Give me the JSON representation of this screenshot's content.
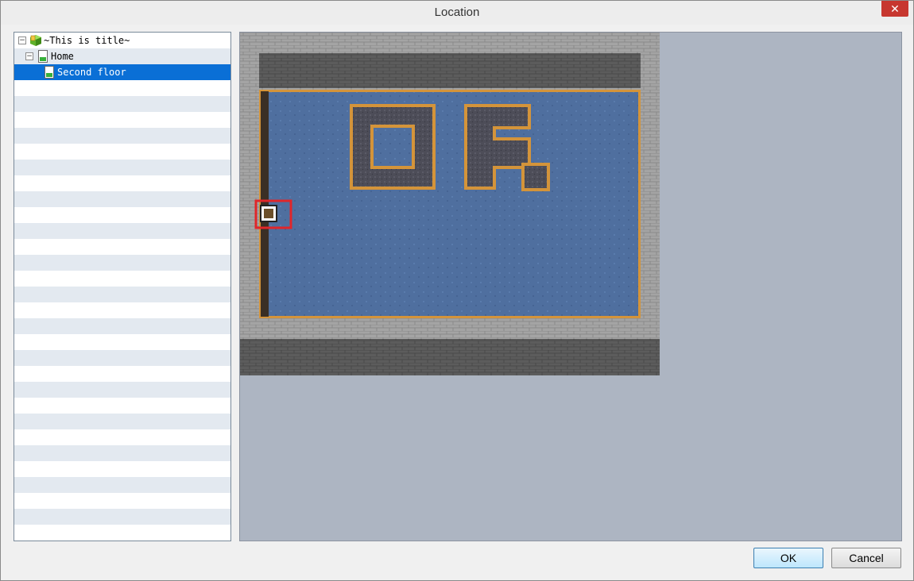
{
  "window": {
    "title": "Location",
    "close_glyph": "✕"
  },
  "tree": {
    "items": [
      {
        "label": "~This is title~",
        "expander": "−",
        "icon": "project-icon"
      },
      {
        "label": "Home",
        "expander": "−",
        "icon": "map-icon"
      },
      {
        "label": "Second floor",
        "icon": "map-icon",
        "selected": true
      }
    ]
  },
  "map": {
    "name": "Second floor",
    "selection_marker": "selected-location-marker"
  },
  "buttons": {
    "ok": "OK",
    "cancel": "Cancel"
  },
  "colors": {
    "selection": "#0a6fd6",
    "row_alt": "#e3e9f0",
    "close": "#c7372f",
    "map_bg": "#adb5c2"
  }
}
